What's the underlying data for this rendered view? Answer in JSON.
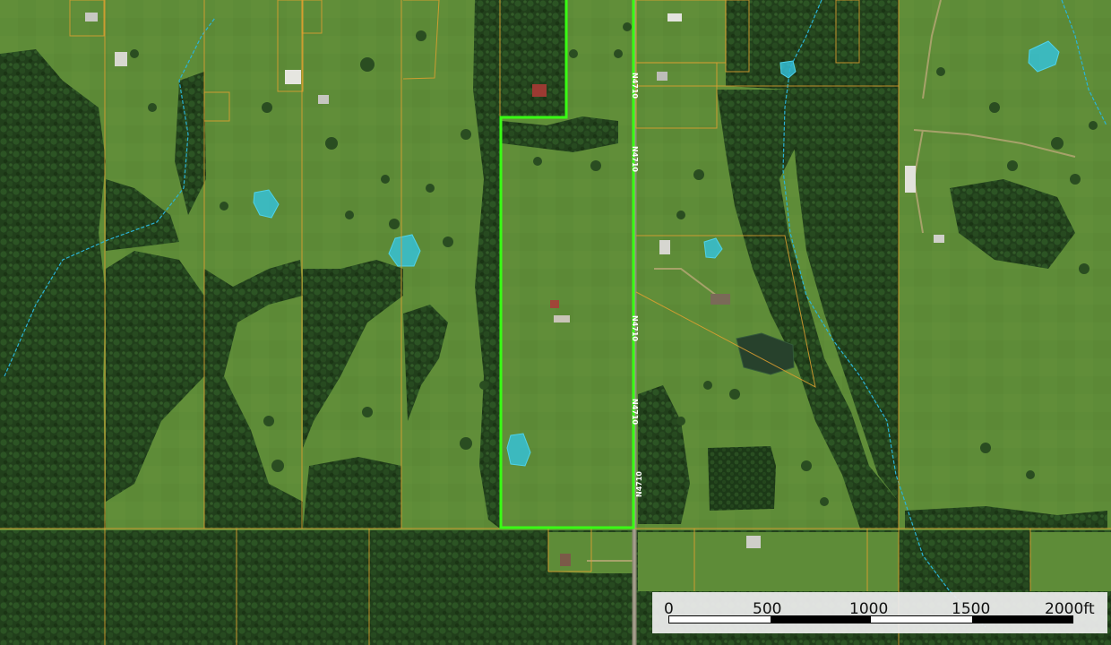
{
  "map": {
    "road_label": "N4710",
    "colors": {
      "parcel_selected": "#39ff14",
      "parcel_line": "#e0a030",
      "water": "#33c4e0",
      "stream": "#2bb3d6",
      "pasture": "#5d8a37",
      "forest": "#1f4119"
    }
  },
  "scale_bar": {
    "ticks": [
      "0",
      "500",
      "1000",
      "1500",
      "2000ft"
    ]
  }
}
